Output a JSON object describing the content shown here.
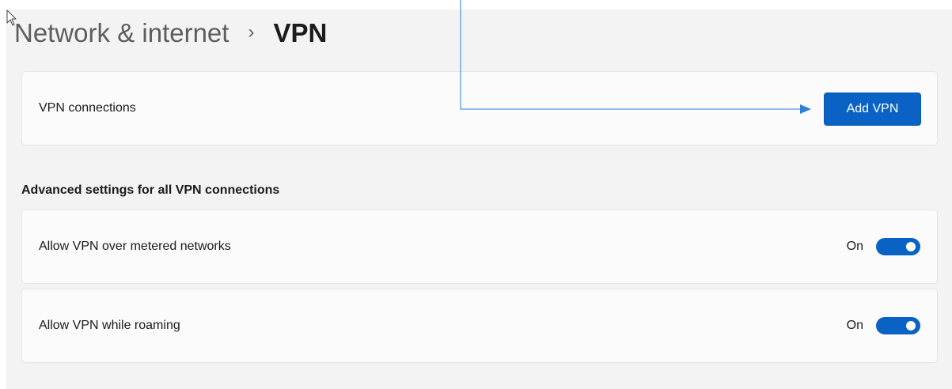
{
  "breadcrumb": {
    "parent": "Network & internet",
    "separator": "›",
    "current": "VPN"
  },
  "vpn_connections": {
    "label": "VPN connections",
    "add_button_label": "Add VPN"
  },
  "advanced": {
    "heading": "Advanced settings for all VPN connections",
    "settings": [
      {
        "label": "Allow VPN over metered networks",
        "state": "On",
        "enabled": true
      },
      {
        "label": "Allow VPN while roaming",
        "state": "On",
        "enabled": true
      }
    ]
  },
  "colors": {
    "accent": "#0a63c4",
    "annotation_line": "#2e7fd6",
    "panel_background": "#f3f3f3",
    "card_background": "#fbfbfb"
  },
  "icons": {
    "pointer": "mouse-cursor-icon",
    "annotation": "arrow-pointer-icon"
  }
}
